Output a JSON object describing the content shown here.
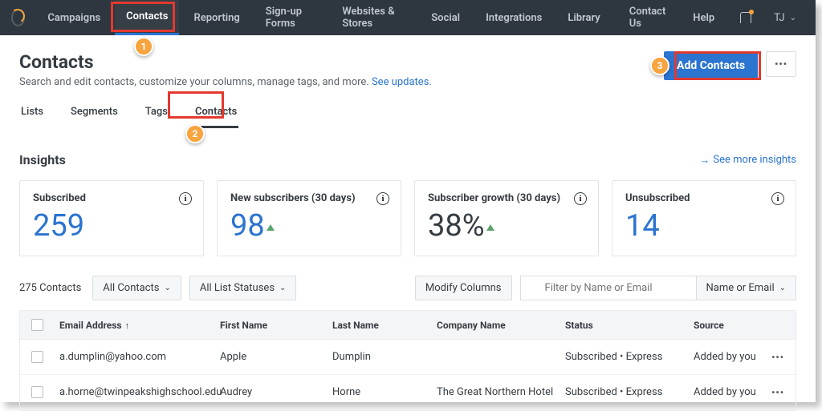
{
  "nav": {
    "items": [
      "Campaigns",
      "Contacts",
      "Reporting",
      "Sign-up Forms",
      "Websites & Stores",
      "Social",
      "Integrations",
      "Library"
    ],
    "right": [
      "Contact Us",
      "Help"
    ],
    "user": "TJ"
  },
  "page": {
    "title": "Contacts",
    "desc": "Search and edit contacts, customize your columns, manage tags, and more. ",
    "updates_link": "See updates.",
    "add_btn": "Add Contacts",
    "more": "•••"
  },
  "subtabs": [
    "Lists",
    "Segments",
    "Tags",
    "Contacts"
  ],
  "insights": {
    "title": "Insights",
    "more": "See more insights",
    "cards": [
      {
        "label": "Subscribed",
        "value": "259"
      },
      {
        "label": "New subscribers (30 days)",
        "value": "98"
      },
      {
        "label": "Subscriber growth (30 days)",
        "value": "38%"
      },
      {
        "label": "Unsubscribed",
        "value": "14"
      }
    ]
  },
  "toolbar": {
    "count": "275 Contacts",
    "all": "All Contacts",
    "status": "All List Statuses",
    "modify": "Modify Columns",
    "search_ph": "Filter by Name or Email",
    "by": "Name or Email"
  },
  "table": {
    "headers": {
      "email": "Email Address",
      "fn": "First Name",
      "ln": "Last Name",
      "co": "Company Name",
      "st": "Status",
      "src": "Source"
    },
    "rows": [
      {
        "email": "a.dumplin@yahoo.com",
        "fn": "Apple",
        "ln": "Dumplin",
        "co": "",
        "st": "Subscribed • Express",
        "src": "Added by you"
      },
      {
        "email": "a.horne@twinpeakshighschool.edu",
        "fn": "Audrey",
        "ln": "Horne",
        "co": "The Great Northern Hotel",
        "st": "Subscribed • Express",
        "src": "Added by you"
      }
    ]
  }
}
